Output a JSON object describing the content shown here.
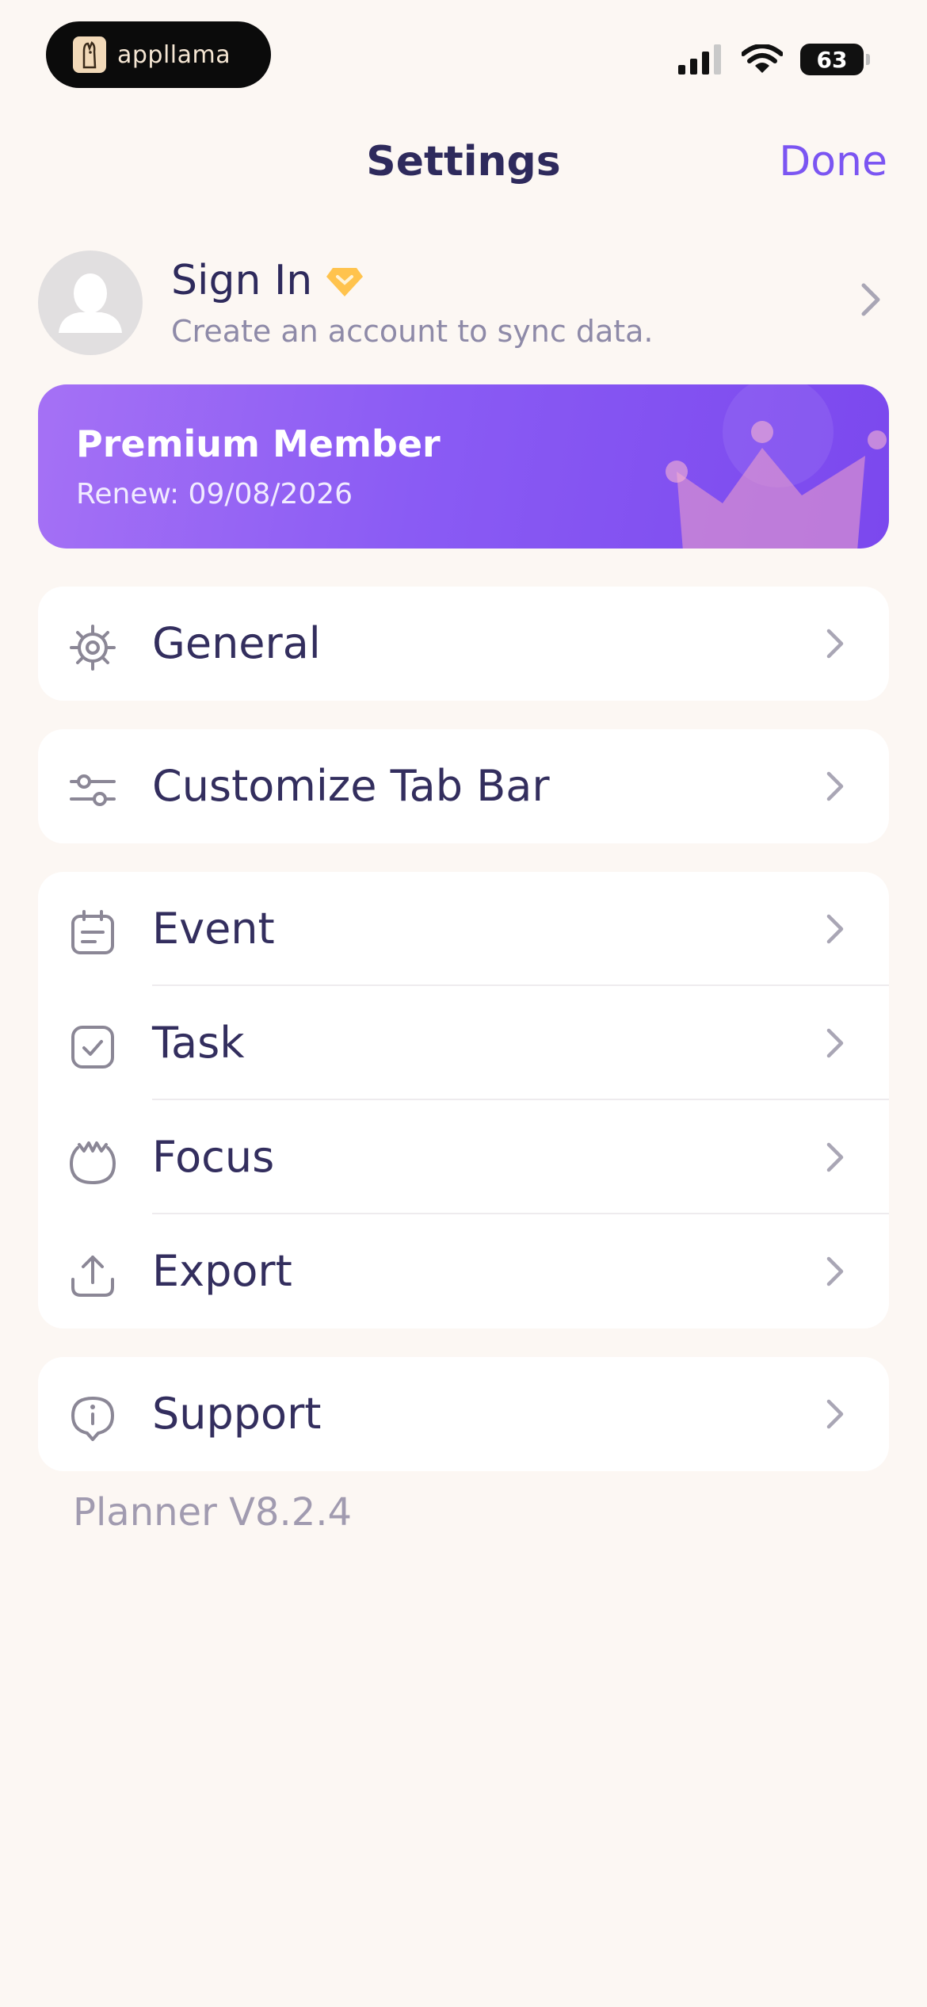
{
  "status_bar": {
    "brand": "appllama",
    "battery": "63"
  },
  "nav": {
    "title": "Settings",
    "done_label": "Done"
  },
  "profile": {
    "title": "Sign In",
    "subtitle": "Create an account to sync data."
  },
  "premium": {
    "title": "Premium Member",
    "renew": "Renew: 09/08/2026"
  },
  "menu": {
    "general": "General",
    "customize_tab_bar": "Customize Tab Bar",
    "event": "Event",
    "task": "Task",
    "focus": "Focus",
    "export": "Export",
    "support": "Support"
  },
  "footer": {
    "version": "Planner V8.2.4"
  },
  "colors": {
    "accent": "#7B55F2",
    "background": "#FCF7F3",
    "text": "#2E2A5C",
    "premium_gradient_start": "#A571F5",
    "premium_gradient_end": "#7B48EE"
  }
}
